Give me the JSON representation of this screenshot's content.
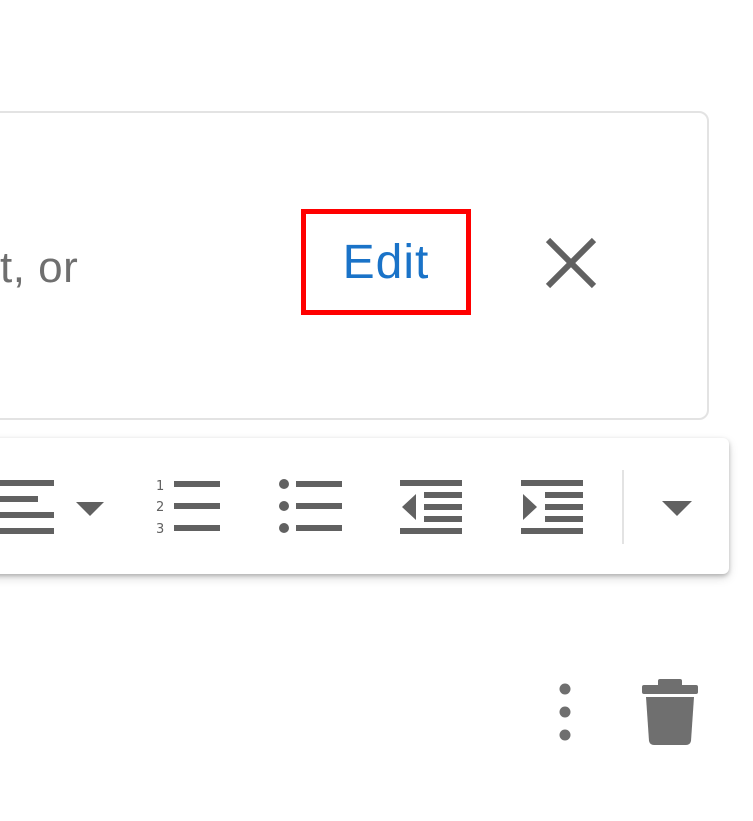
{
  "info_card": {
    "partial_text": "t, or",
    "edit_label": "Edit",
    "close_icon": "close-icon"
  },
  "toolbar": {
    "buttons": [
      {
        "icon": "align-left-dropdown-icon"
      },
      {
        "icon": "numbered-list-icon"
      },
      {
        "icon": "bulleted-list-icon"
      },
      {
        "icon": "decrease-indent-icon"
      },
      {
        "icon": "increase-indent-icon"
      },
      {
        "icon": "more-options-chevron-icon"
      }
    ],
    "icon_color": "#616161"
  },
  "actions": {
    "more_icon": "more-vert-icon",
    "delete_icon": "trash-icon",
    "icon_color": "#6f6f6f"
  },
  "colors": {
    "accent": "#1a73c8",
    "highlight": "#ff0000",
    "border": "#e3e3e3",
    "text_secondary": "#6f6f6f"
  }
}
